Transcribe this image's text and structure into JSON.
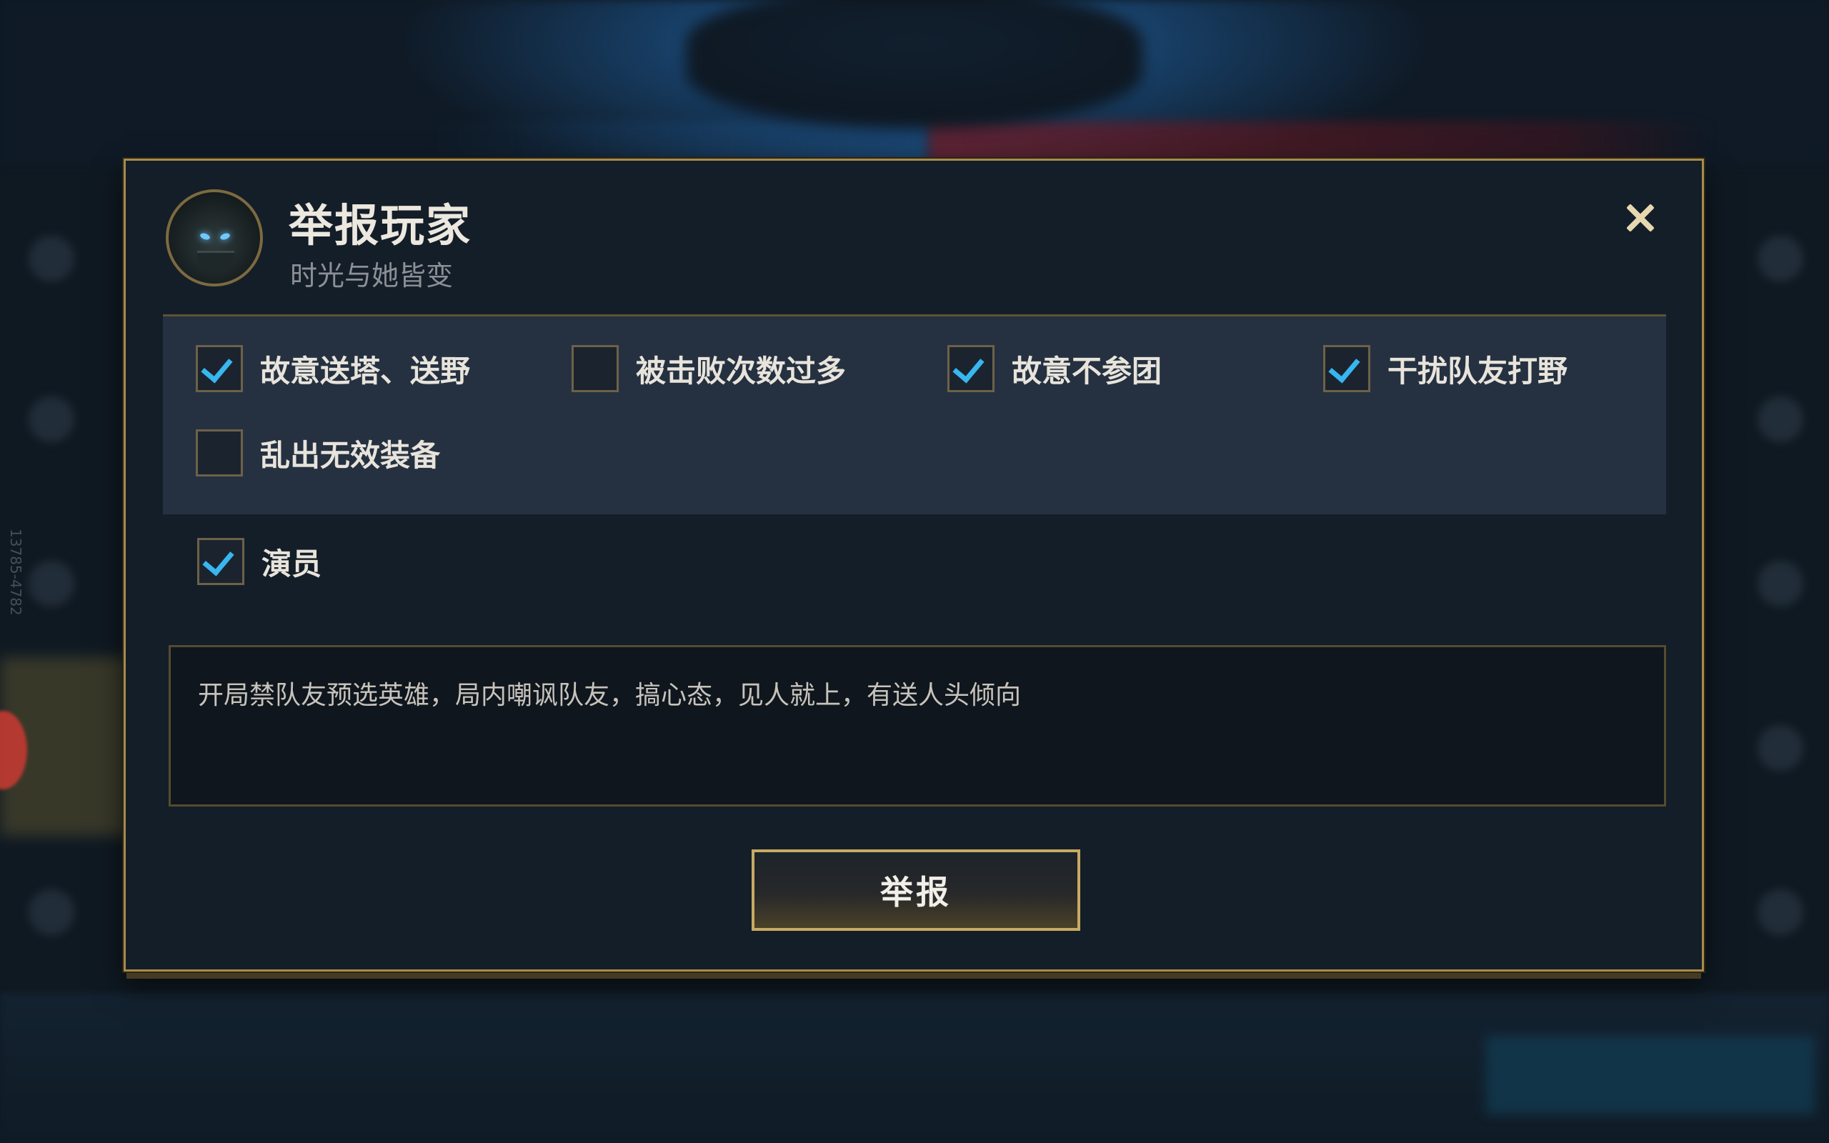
{
  "dialog": {
    "title": "举报玩家",
    "player_name": "时光与她皆变",
    "close_icon": "close-icon",
    "categories": [
      {
        "label": "故意送塔、送野",
        "checked": true
      },
      {
        "label": "被击败次数过多",
        "checked": false
      },
      {
        "label": "故意不参团",
        "checked": true
      },
      {
        "label": "干扰队友打野",
        "checked": true
      },
      {
        "label": "乱出无效装备",
        "checked": false
      }
    ],
    "extra_option": {
      "label": "演员",
      "checked": true
    },
    "description": "开局禁队友预选英雄，局内嘲讽队友，搞心态，见人就上，有送人头倾向",
    "submit_label": "举报"
  },
  "side_id": "13785-4782",
  "colors": {
    "accent_gold": "#a88b4a",
    "check_blue": "#38b6f0",
    "panel_bg": "#253140",
    "dialog_bg": "#141e28"
  }
}
